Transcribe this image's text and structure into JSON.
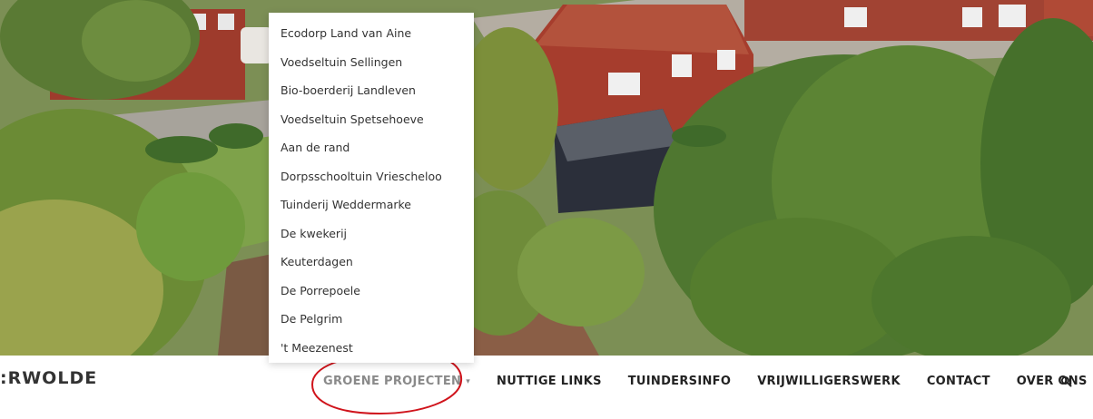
{
  "site": {
    "name": ":RWOLDE"
  },
  "nav": {
    "items": [
      {
        "label": "GROENE PROJECTEN",
        "active": true,
        "has_dropdown": true
      },
      {
        "label": "NUTTIGE LINKS",
        "active": false
      },
      {
        "label": "TUINDERSINFO",
        "active": false
      },
      {
        "label": "VRIJWILLIGERSWERK",
        "active": false
      },
      {
        "label": "CONTACT",
        "active": false
      },
      {
        "label": "OVER ONS",
        "active": false
      }
    ],
    "search_icon": "search-icon",
    "caret_icon": "chevron-down-icon"
  },
  "dropdown": {
    "items": [
      "Ecodorp Land van Aine",
      "Voedseltuin Sellingen",
      "Bio-boerderij Landleven",
      "Voedseltuin Spetsehoeve",
      "Aan de rand",
      "Dorpsschooltuin Vriescheloo",
      "Tuinderij Weddermarke",
      "De kwekerij",
      "Keuterdagen",
      "De Porrepoele",
      "De Pelgrim",
      "'t Meezenest"
    ]
  },
  "colors": {
    "nav_text": "#222222",
    "nav_active": "#8a8a8a",
    "annotation": "#d0141c"
  }
}
